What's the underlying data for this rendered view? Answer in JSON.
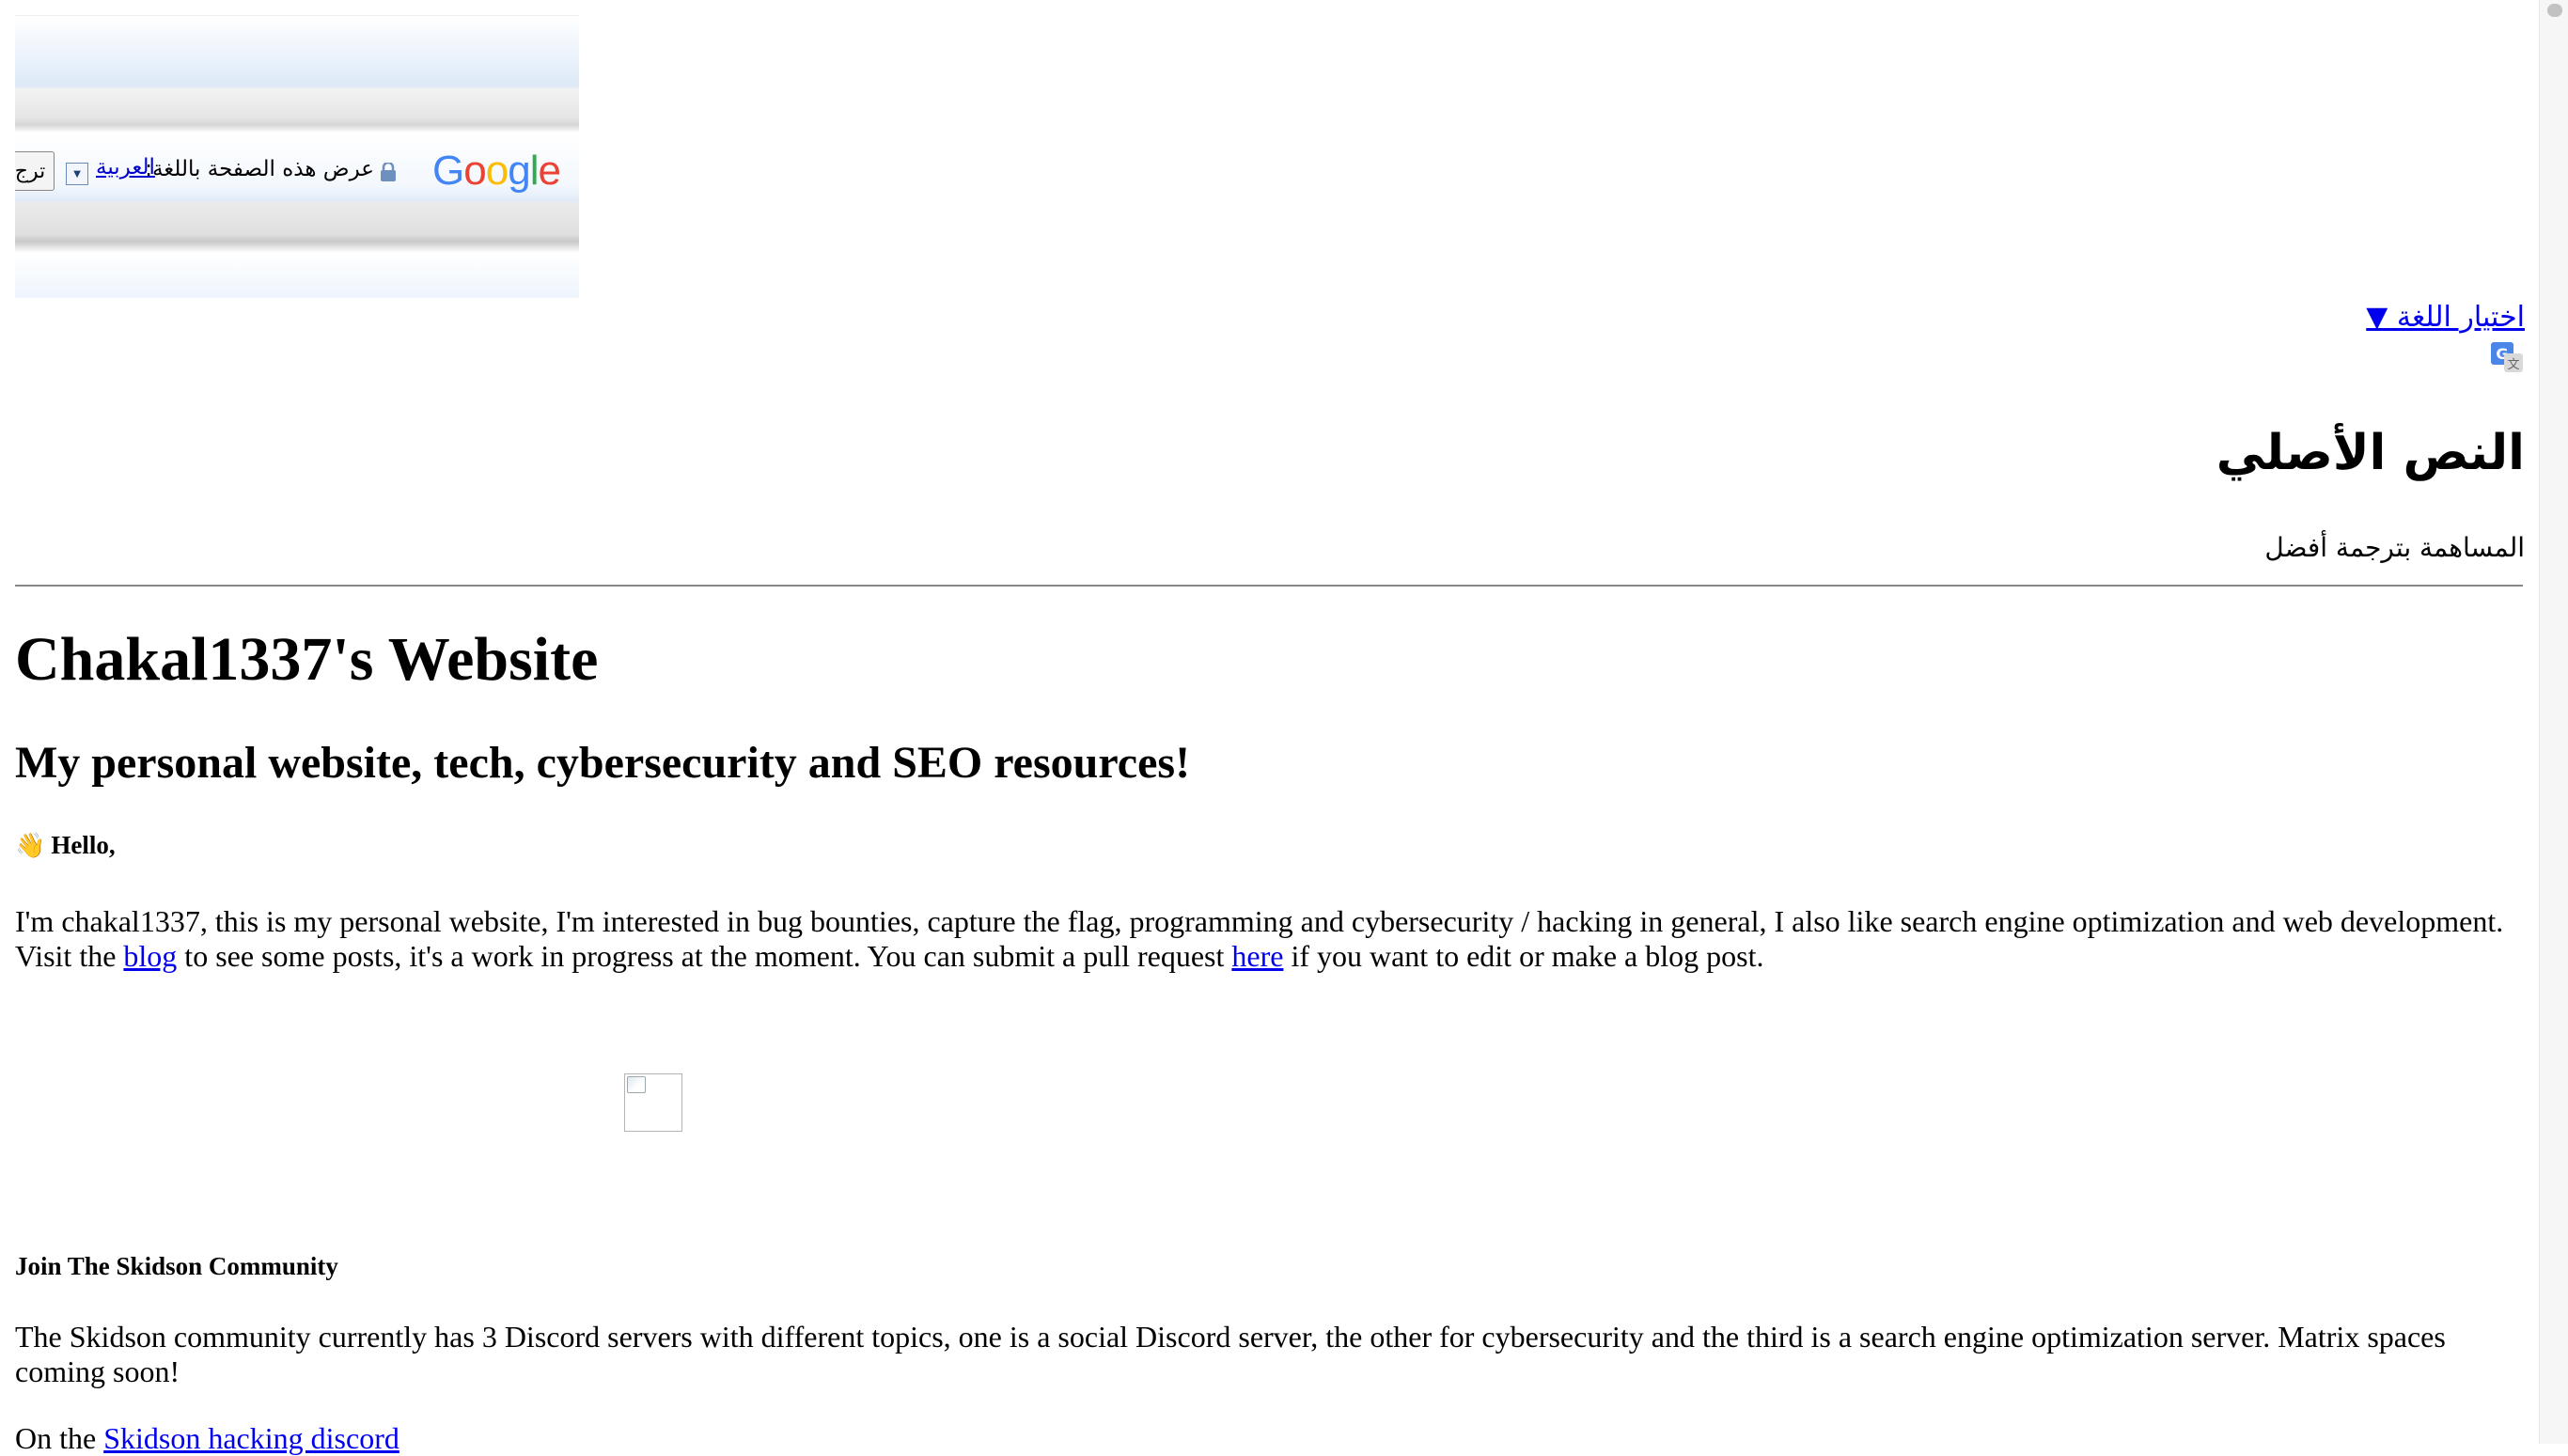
{
  "translate_banner": {
    "logo": "Google",
    "view_text": "عرض هذه الصفحة باللغة:",
    "language": "العربية",
    "dropdown_arrow": "▼",
    "translate_button": "ترج",
    "lock_icon": "lock-icon"
  },
  "language_selector": {
    "label": "اختيار اللغة ▼",
    "icon": "google-translate-icon"
  },
  "original_text": {
    "heading": "النص الأصلي",
    "contribute": "المساهمة بترجمة أفضل"
  },
  "site": {
    "title": "Chakal1337's Website",
    "subtitle": "My personal website, tech, cybersecurity and SEO resources!",
    "greeting_emoji": "👋",
    "greeting": "Hello,",
    "intro_part1": "I'm chakal1337, this is my personal website, I'm interested in bug bounties, capture the flag, programming and cybersecurity / hacking in general, I also like search engine optimization and web development. Visit the ",
    "blog_link": "blog",
    "intro_part2": " to see some posts, it's a work in progress at the moment. You can submit a pull request ",
    "here_link": "here",
    "intro_part3": " if you want to edit or make a blog post.",
    "community_heading": "Join The Skidson Community",
    "community_text": "The Skidson community currently has 3 Discord servers with different topics, one is a social Discord server, the other for cybersecurity and the third is a search engine optimization server. Matrix spaces coming soon!",
    "discord_prefix": "On the ",
    "discord_link": "Skidson hacking discord"
  },
  "colors": {
    "link": "#0000ee",
    "rule": "#888888"
  }
}
